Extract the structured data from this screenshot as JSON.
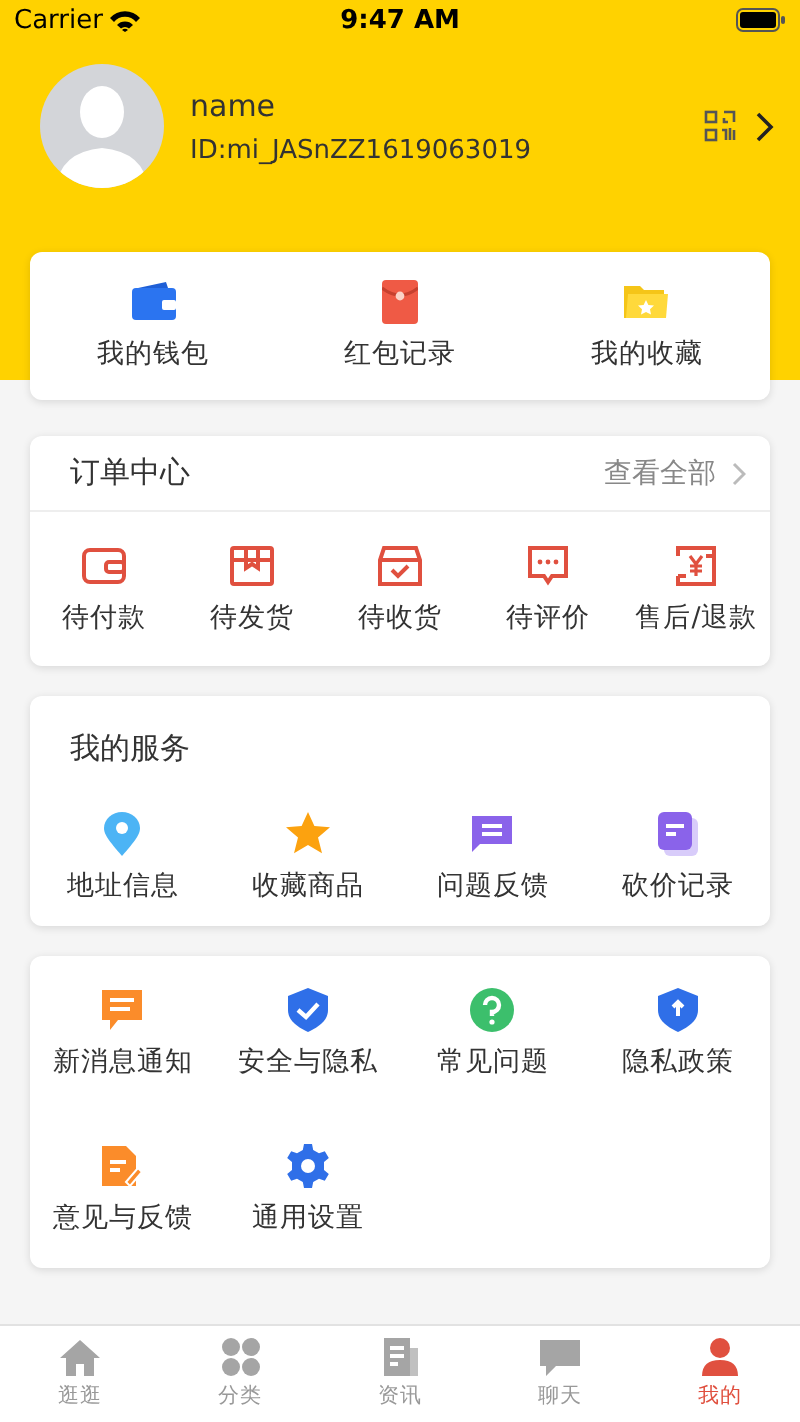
{
  "status_bar": {
    "carrier": "Carrier",
    "time": "9:47 AM"
  },
  "profile": {
    "name": "name",
    "user_id": "ID:mi_JASnZZ1619063019"
  },
  "quick_links": [
    {
      "label": "我的钱包"
    },
    {
      "label": "红包记录"
    },
    {
      "label": "我的收藏"
    }
  ],
  "orders": {
    "title": "订单中心",
    "view_all": "查看全部",
    "items": [
      {
        "label": "待付款"
      },
      {
        "label": "待发货"
      },
      {
        "label": "待收货"
      },
      {
        "label": "待评价"
      },
      {
        "label": "售后/退款"
      }
    ]
  },
  "services": {
    "title": "我的服务",
    "items": [
      {
        "label": "地址信息"
      },
      {
        "label": "收藏商品"
      },
      {
        "label": "问题反馈"
      },
      {
        "label": "砍价记录"
      }
    ]
  },
  "settings": {
    "items": [
      {
        "label": "新消息通知"
      },
      {
        "label": "安全与隐私"
      },
      {
        "label": "常见问题"
      },
      {
        "label": "隐私政策"
      },
      {
        "label": "意见与反馈"
      },
      {
        "label": "通用设置"
      }
    ]
  },
  "tab_bar": [
    {
      "label": "逛逛",
      "selected": false
    },
    {
      "label": "分类",
      "selected": false
    },
    {
      "label": "资讯",
      "selected": false
    },
    {
      "label": "聊天",
      "selected": false
    },
    {
      "label": "我的",
      "selected": true
    }
  ]
}
